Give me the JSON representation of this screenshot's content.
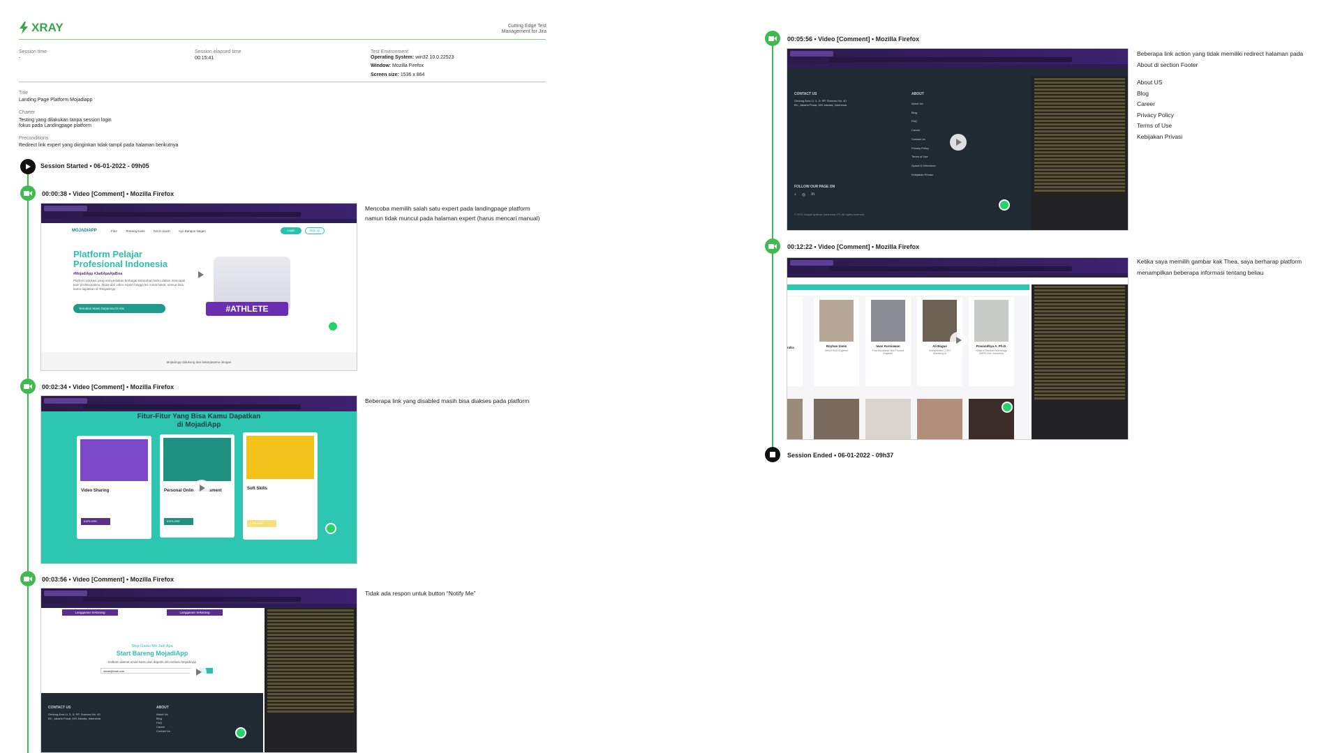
{
  "header": {
    "logo_text": "XRAY",
    "tagline": "Cutting Edge Test Management for Jira",
    "session_time_label": "Session time",
    "session_time_value": "-",
    "elapsed_label": "Session elapsed time",
    "elapsed_value": "00:15:41",
    "env_label": "Test Environment",
    "os_label": "Operating System:",
    "os_value": "win32 10.0.22523",
    "window_label": "Window:",
    "window_value": "Mozilla Firefox",
    "screen_label": "Screen size:",
    "screen_value": "1536 x 864"
  },
  "details": {
    "title_label": "Title",
    "title_value": "Landing Page Platform Mojadiapp",
    "charter_label": "Charter",
    "charter_line1": "Testing yang dilakukan tanpa session login",
    "charter_line2": "fokus pada Landingpage platform",
    "precond_label": "Preconditions",
    "precond_value": "Redirect link expert yang diinginkan tidak tampil pada halaman berikutnya"
  },
  "timeline": {
    "start": "Session Started • 06-01-2022 - 09h05",
    "end": "Session Ended • 06-01-2022 - 09h37",
    "events": [
      {
        "title": "00:00:38 • Video [Comment] • Mozilla Firefox",
        "comment": [
          "Mencoba memilih salah satu expert pada landingpage platform",
          "namun tidak muncul pada halaman expert (harus mencari manual)"
        ]
      },
      {
        "title": "00:02:34 • Video [Comment] • Mozilla Firefox",
        "comment": [
          "Beberapa link yang disabled masih bisa diakses pada platform"
        ]
      },
      {
        "title": "00:03:56 • Video [Comment] • Mozilla Firefox",
        "comment": [
          "Tidak ada respon untuk button “Notify Me”"
        ]
      },
      {
        "title": "00:05:56 • Video [Comment] • Mozilla Firefox",
        "comment": [
          "Beberapa link action yang tidak memiliki redirect halaman pada",
          "About di section Footer",
          "",
          "About US",
          "Blog",
          "Career",
          "Privacy Policy",
          "Terms of Use",
          "Kebijakan Privasi"
        ]
      },
      {
        "title": "00:12:22 • Video [Comment] • Mozilla Firefox",
        "comment": [
          "Ketika saya memilih gambar kak Thea, saya berharap platform",
          "menampilkan beberapa informasi tentang beliau"
        ]
      }
    ]
  },
  "shot1": {
    "nav_logo": "MOJADIAPP",
    "nav": [
      "Fitur",
      "Tentang Kami",
      "Get in touch",
      "Ayo Bangun Negeri"
    ],
    "login": "Login",
    "signup": "Sign up",
    "h1a": "Platform Pelajar",
    "h1b": "Profesional Indonesia",
    "hash": "#MojadiApp #JadiApaAjaBisa",
    "body": "Platform edukasi yang menyediakan berbagai kebutuhan kamu dalam mencapai karir profesionalmu. Mulai dari video expert hingga les minat bakat, semua bisa kamu dapatkan di #MojadiApp",
    "cta": "Temukan Mass Depanmu Di Sini",
    "athlete": "#ATHLETE",
    "foot": "MojadiApp didukung dan bekerjasama dengan"
  },
  "shot2": {
    "title1": "Fitur-Fitur Yang Bisa Kamu Dapatkan",
    "title2": "di MojadiApp",
    "cards": [
      {
        "name": "Video Sharing",
        "btn": "EXPLORE"
      },
      {
        "name": "Personal Online Assessment",
        "btn": "EXPLORE"
      },
      {
        "name": "Soft Skills",
        "btn": "EXPLORE"
      }
    ]
  },
  "shot3": {
    "btn1": "Langganan Sekarang",
    "btn2": "Langganan Sekarang",
    "stop": "Stop Galau Mo Jadi Apa",
    "start": "Start Bareng MojadiApp",
    "sub": "Daftarin alamat email kamu dan dapetin info terbaru MojadiApp",
    "email": "name@mail.com",
    "contact": "CONTACT US",
    "about": "ABOUT",
    "addr": "Gedung Arva Lt. 3, Jl. RP. Soeroso No. 40 BC, Jakarta Pusat, DKI Jakarta, Indonesia",
    "links": [
      "About Us",
      "Blog",
      "FAQ",
      "Career",
      "Contact Us"
    ]
  },
  "shot4": {
    "contact": "CONTACT US",
    "about": "ABOUT",
    "addr": "Gedung Arva Lt. 3, Jl. RP. Soeroso No. 40 BC, Jakarta Pusat, DKI Jakarta, Indonesia",
    "links": [
      "About Us",
      "Blog",
      "FAQ",
      "Career",
      "Contact Us",
      "Privacy Policy",
      "Terms of Use",
      "Syarat & Ketentuan",
      "Kebijakan Privasi"
    ],
    "follow": "FOLLOW OUR PAGE ON",
    "copy": "© 2021 Mojadi Aplikasi Indonesia, PT. All rights reserved."
  },
  "shot5": {
    "people": [
      {
        "name": "Royhan Zanis",
        "role": "Senior R&D Engineer"
      },
      {
        "name": "Iwan Kurniawan",
        "role": "Flow Assurance and Process Engineer"
      },
      {
        "name": "Ali Bagus",
        "role": "Entrepreneur | CEO Bonstring.id"
      },
      {
        "name": "Prasandhya A. Ph.D.",
        "role": "Head of Medical Technology IMERI Univ. Indonesia"
      }
    ],
    "partial_left": "ndra"
  }
}
